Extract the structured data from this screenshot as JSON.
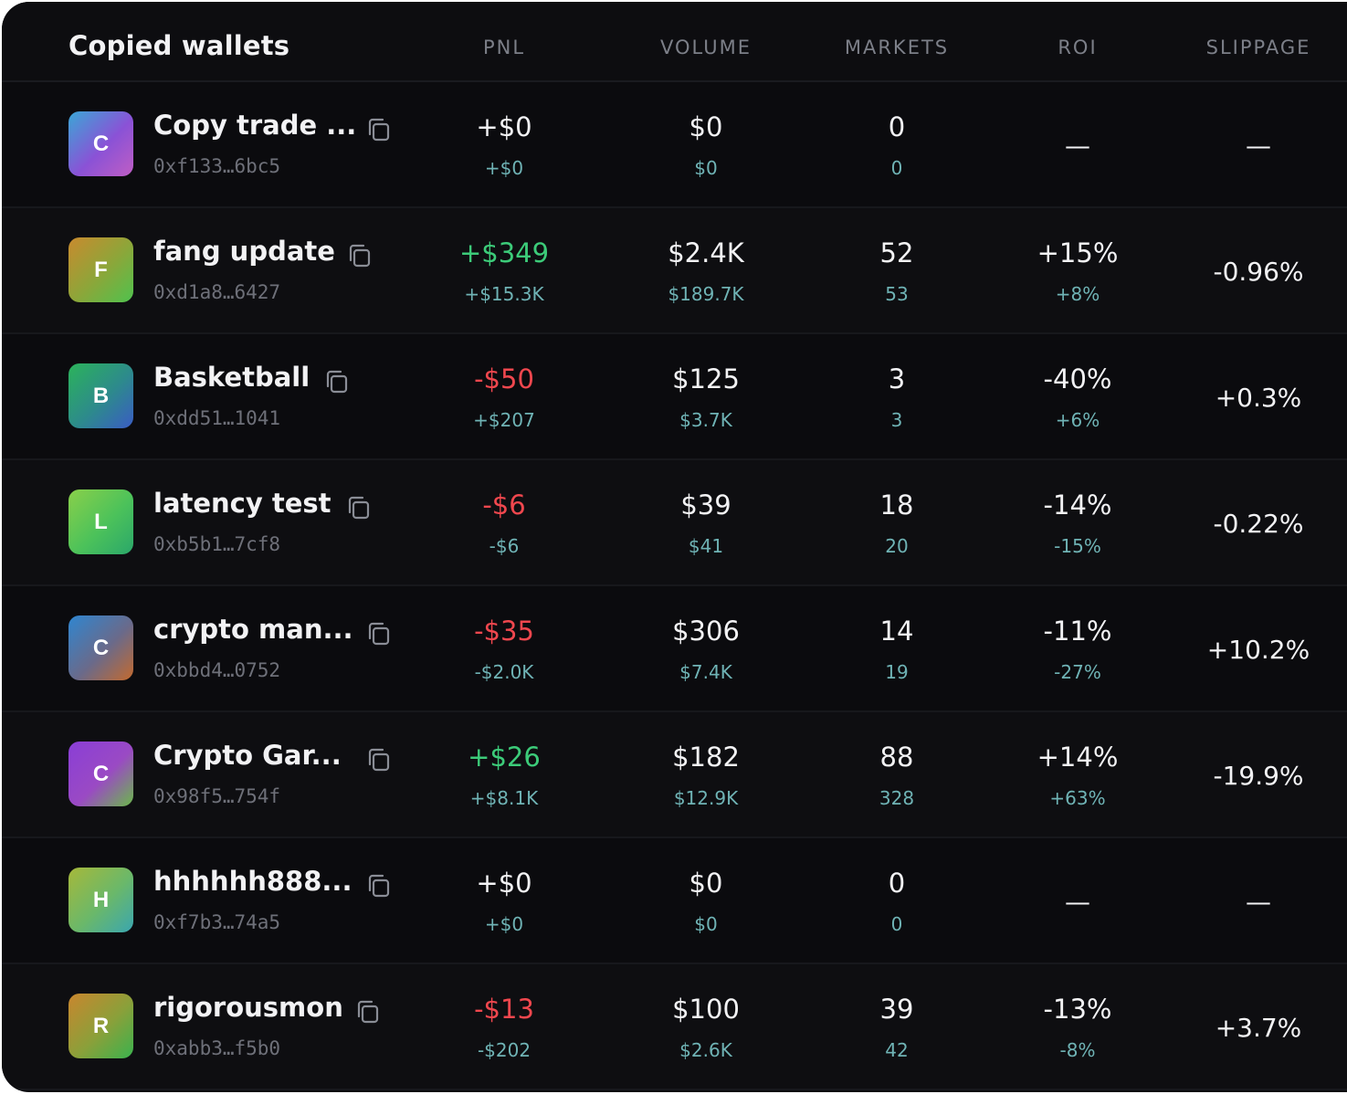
{
  "header": {
    "title": "Copied wallets",
    "columns": [
      "PNL",
      "VOLUME",
      "MARKETS",
      "ROI",
      "SLIPPAGE"
    ]
  },
  "colors": {
    "background": "#0b0b0e",
    "positive": "#3ccb79",
    "negative": "#f0474e",
    "secondary_value": "#6fb3b5",
    "muted": "#7c7f88"
  },
  "wallets": [
    {
      "initial": "C",
      "name": "Copy trade ...",
      "address": "0xf133…6bc5",
      "avatar_gradient": [
        "#3aa7d6",
        "#8a52d6",
        "#c05ec4"
      ],
      "pnl": "+$0",
      "pnl_status": "neutral",
      "pnl_sub": "+$0",
      "volume": "$0",
      "volume_sub": "$0",
      "markets": "0",
      "markets_sub": "0",
      "roi": "—",
      "roi_sub": "",
      "slippage": "—"
    },
    {
      "initial": "F",
      "name": "fang update",
      "address": "0xd1a8…6427",
      "avatar_gradient": [
        "#c98a2e",
        "#8aa73a",
        "#4fc24e"
      ],
      "pnl": "+$349",
      "pnl_status": "positive",
      "pnl_sub": "+$15.3K",
      "volume": "$2.4K",
      "volume_sub": "$189.7K",
      "markets": "52",
      "markets_sub": "53",
      "roi": "+15%",
      "roi_sub": "+8%",
      "slippage": "-0.96%"
    },
    {
      "initial": "B",
      "name": "Basketball",
      "address": "0xdd51…1041",
      "avatar_gradient": [
        "#2cb35a",
        "#2d8a8c",
        "#3a5cc4"
      ],
      "pnl": "-$50",
      "pnl_status": "negative",
      "pnl_sub": "+$207",
      "volume": "$125",
      "volume_sub": "$3.7K",
      "markets": "3",
      "markets_sub": "3",
      "roi": "-40%",
      "roi_sub": "+6%",
      "slippage": "+0.3%"
    },
    {
      "initial": "L",
      "name": "latency test",
      "address": "0xb5b1…7cf8",
      "avatar_gradient": [
        "#8ad04a",
        "#4cc25a",
        "#2aa76a"
      ],
      "pnl": "-$6",
      "pnl_status": "negative",
      "pnl_sub": "-$6",
      "volume": "$39",
      "volume_sub": "$41",
      "markets": "18",
      "markets_sub": "20",
      "roi": "-14%",
      "roi_sub": "-15%",
      "slippage": "-0.22%"
    },
    {
      "initial": "C",
      "name": "crypto man...",
      "address": "0xbbd4…0752",
      "avatar_gradient": [
        "#2f86d0",
        "#6a6a8a",
        "#c46a2e"
      ],
      "pnl": "-$35",
      "pnl_status": "negative",
      "pnl_sub": "-$2.0K",
      "volume": "$306",
      "volume_sub": "$7.4K",
      "markets": "14",
      "markets_sub": "19",
      "roi": "-11%",
      "roi_sub": "-27%",
      "slippage": "+10.2%"
    },
    {
      "initial": "C",
      "name": "Crypto Gar...",
      "address": "0x98f5…754f",
      "avatar_gradient": [
        "#8a3ed6",
        "#9a4ac4",
        "#6ab84a"
      ],
      "pnl": "+$26",
      "pnl_status": "positive",
      "pnl_sub": "+$8.1K",
      "volume": "$182",
      "volume_sub": "$12.9K",
      "markets": "88",
      "markets_sub": "328",
      "roi": "+14%",
      "roi_sub": "+63%",
      "slippage": "-19.9%"
    },
    {
      "initial": "H",
      "name": "hhhhhh888...",
      "address": "0xf7b3…74a5",
      "avatar_gradient": [
        "#a6b83a",
        "#6ab86a",
        "#3aa6b0"
      ],
      "pnl": "+$0",
      "pnl_status": "neutral",
      "pnl_sub": "+$0",
      "volume": "$0",
      "volume_sub": "$0",
      "markets": "0",
      "markets_sub": "0",
      "roi": "—",
      "roi_sub": "",
      "slippage": "—"
    },
    {
      "initial": "R",
      "name": "rigorousmon",
      "address": "0xabb3…f5b0",
      "avatar_gradient": [
        "#c9862e",
        "#8aa03a",
        "#3ab24e"
      ],
      "pnl": "-$13",
      "pnl_status": "negative",
      "pnl_sub": "-$202",
      "volume": "$100",
      "volume_sub": "$2.6K",
      "markets": "39",
      "markets_sub": "42",
      "roi": "-13%",
      "roi_sub": "-8%",
      "slippage": "+3.7%"
    }
  ]
}
